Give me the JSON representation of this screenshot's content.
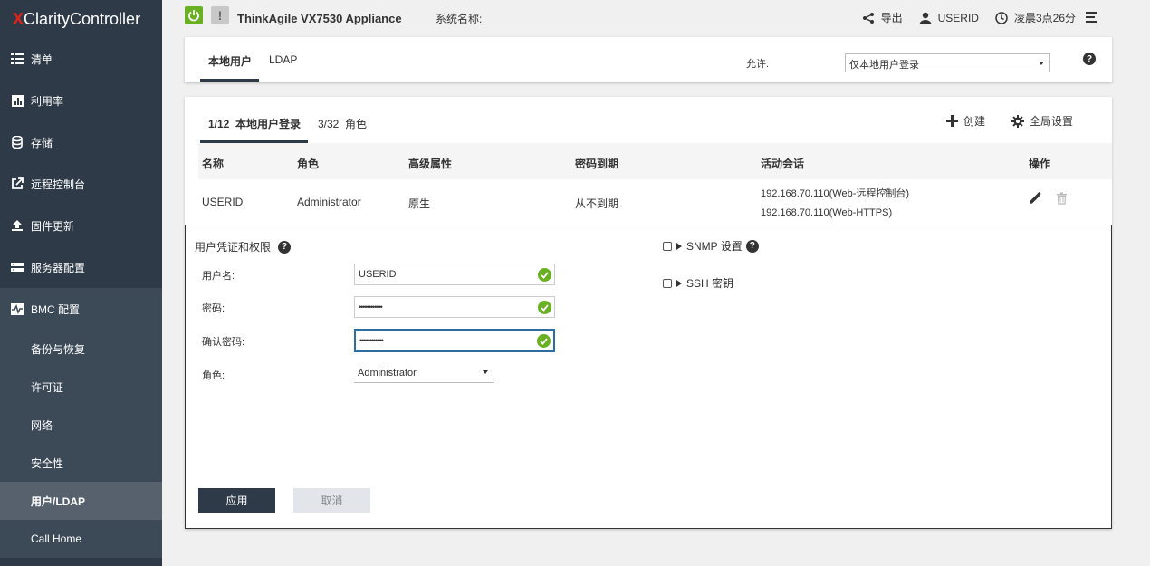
{
  "app": {
    "brand_x": "X",
    "brand_rest": "Clarity",
    "brand_suffix": " Controller"
  },
  "sidebar": {
    "items": [
      {
        "label": "清单",
        "icon": "list-icon"
      },
      {
        "label": "利用率",
        "icon": "chart-icon"
      },
      {
        "label": "存储",
        "icon": "database-icon"
      },
      {
        "label": "远程控制台",
        "icon": "external-icon"
      },
      {
        "label": "固件更新",
        "icon": "upload-icon"
      },
      {
        "label": "服务器配置",
        "icon": "server-icon"
      },
      {
        "label": "BMC 配置",
        "icon": "pulse-icon"
      }
    ],
    "sub_items": [
      {
        "label": "备份与恢复"
      },
      {
        "label": "许可证"
      },
      {
        "label": "网络"
      },
      {
        "label": "安全性"
      },
      {
        "label": "用户/LDAP"
      },
      {
        "label": "Call Home"
      }
    ]
  },
  "topbar": {
    "warn": "!",
    "product": "ThinkAgile VX7530 Appliance",
    "system_name_label": "系统名称:",
    "export": "导出",
    "user": "USERID",
    "time": "凌晨3点26分"
  },
  "tabs": {
    "local": "本地用户",
    "ldap": "LDAP",
    "allow_label": "允许:",
    "allow_value": "仅本地用户登录"
  },
  "subtabs": {
    "count1": "1/12",
    "users": "本地用户登录",
    "count2": "3/32",
    "roles": "角色",
    "create": "创建",
    "global": "全局设置"
  },
  "table": {
    "headers": [
      "名称",
      "角色",
      "高级属性",
      "密码到期",
      "活动会话",
      "操作"
    ],
    "row": {
      "name": "USERID",
      "role": "Administrator",
      "attr": "原生",
      "expiry": "从不到期",
      "session1": "192.168.70.110(Web-远程控制台)",
      "session2": "192.168.70.110(Web-HTTPS)"
    }
  },
  "editor": {
    "title": "用户凭证和权限",
    "username_label": "用户名:",
    "username_value": "USERID",
    "password_label": "密码:",
    "password_value": "••••••••••••",
    "confirm_label": "确认密码:",
    "confirm_value": "••••••••••••",
    "role_label": "角色:",
    "role_value": "Administrator",
    "snmp": "SNMP 设置",
    "ssh": "SSH 密钥",
    "apply": "应用",
    "cancel": "取消"
  },
  "colors": {
    "sidebar": "#2e3a47",
    "power_on": "#6ab023",
    "accent": "#2e6da4"
  }
}
